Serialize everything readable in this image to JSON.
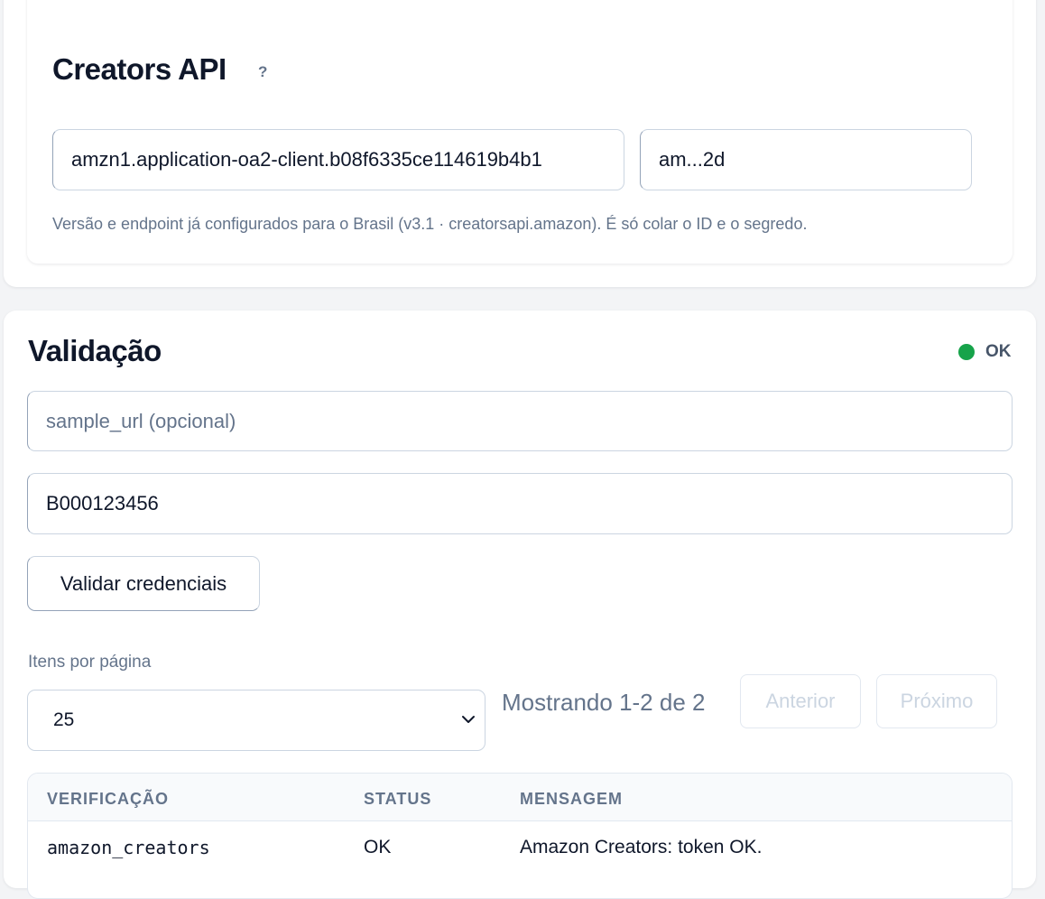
{
  "creators": {
    "title": "Creators API",
    "help_label": "?",
    "client_id_value": "amzn1.application-oa2-client.b08f6335ce114619b4b1",
    "client_secret_value": "am...2d",
    "hint": "Versão e endpoint já configurados para o Brasil (v3.1 · creatorsapi.amazon). É só colar o ID e o segredo."
  },
  "validacao": {
    "title": "Validação",
    "status_label": "OK",
    "status_color": "#16a34a",
    "sample_url_placeholder": "sample_url (opcional)",
    "asin_value": "B000123456",
    "validate_button": "Validar credenciais"
  },
  "pagination": {
    "per_page_label": "Itens por página",
    "per_page_value": "25",
    "showing": "Mostrando 1-2 de 2",
    "prev_label": "Anterior",
    "next_label": "Próximo"
  },
  "table": {
    "headers": [
      "VERIFICAÇÃO",
      "STATUS",
      "MENSAGEM"
    ],
    "rows": [
      {
        "check": "amazon_creators",
        "status": "OK",
        "message": "Amazon Creators: token OK."
      }
    ]
  }
}
